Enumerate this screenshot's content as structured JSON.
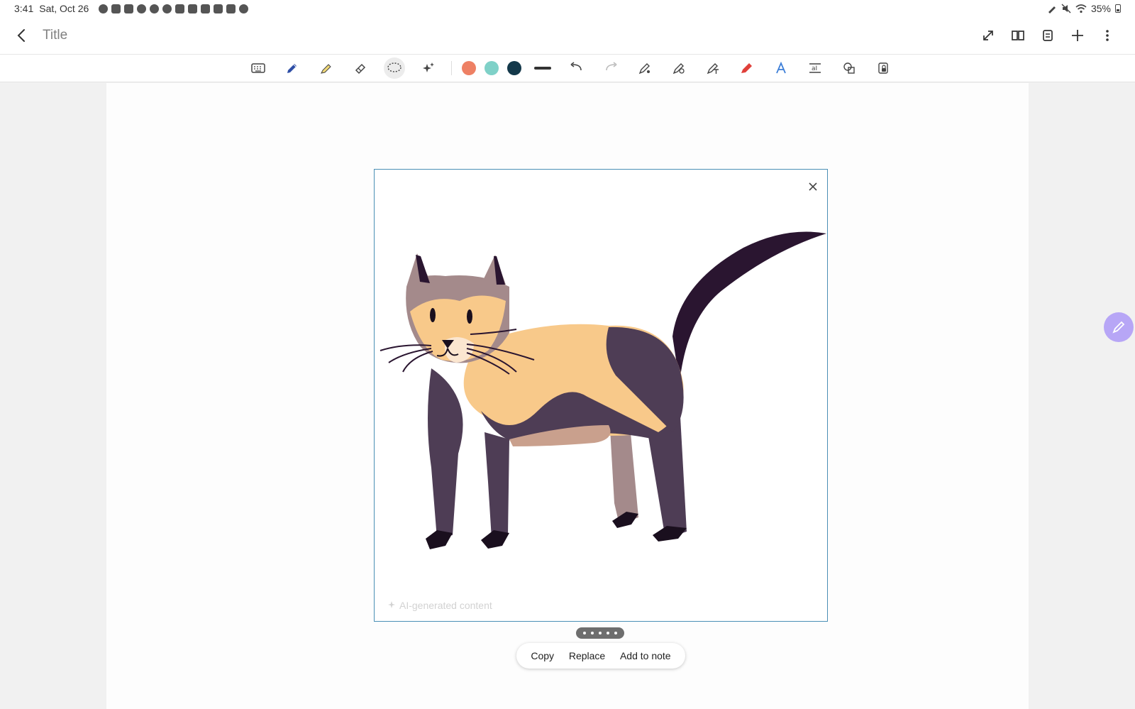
{
  "status_bar": {
    "time": "3:41",
    "date": "Sat, Oct 26",
    "battery": "35%",
    "notification_icons": [
      "messenger-icon",
      "play-store-icon",
      "lock-icon",
      "google-icon",
      "google-icon",
      "chrome-icon",
      "shield-icon",
      "mail-icon",
      "shield-icon",
      "gallery-icon",
      "download-icon",
      "cloud-icon"
    ]
  },
  "header": {
    "title": "Title",
    "actions": [
      "expand-icon",
      "book-view-icon",
      "page-list-icon",
      "add-icon",
      "more-icon"
    ]
  },
  "toolbar": {
    "tools": [
      "keyboard",
      "pen",
      "highlighter",
      "eraser",
      "lasso",
      "ai-assist"
    ],
    "selected_tool": "lasso",
    "colors": [
      "#ee8064",
      "#7fd1c8",
      "#13384a"
    ],
    "secondary_tools": [
      "pen-settings",
      "ink-to-shape",
      "ink-to-text",
      "marker",
      "text-style",
      "text-box",
      "shapes",
      "lock"
    ]
  },
  "image_panel": {
    "ai_label": "AI-generated content",
    "pager_dots": 5,
    "actions": {
      "copy": "Copy",
      "replace": "Replace",
      "add_to_note": "Add to note"
    }
  }
}
